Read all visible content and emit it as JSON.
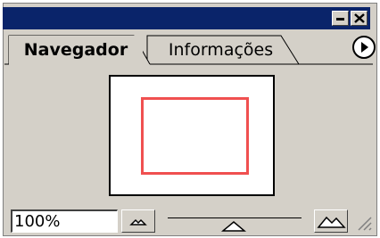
{
  "window": {
    "minimize_icon": "minimize-icon",
    "close_icon": "close-icon",
    "titlebar_color": "#0a246a"
  },
  "tabs": [
    {
      "label": "Navegador",
      "active": true
    },
    {
      "label": "Informações",
      "active": false
    }
  ],
  "menu_icon": "panel-menu-arrow-icon",
  "preview": {
    "view_rect_color": "#f05050"
  },
  "zoom": {
    "value": "100%",
    "zoom_out_icon": "small-mountain-icon",
    "zoom_in_icon": "large-mountain-icon",
    "slider_icon": "slider-thumb-icon"
  }
}
